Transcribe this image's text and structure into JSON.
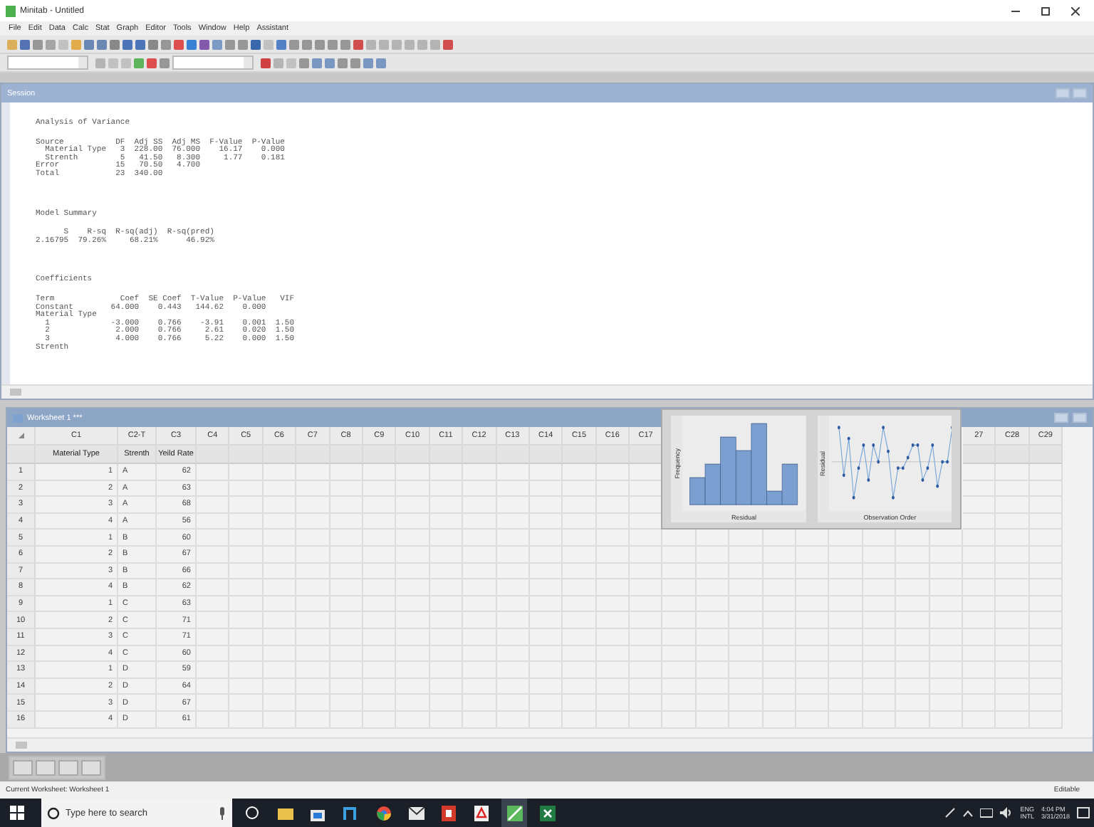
{
  "window": {
    "title": "Minitab - Untitled"
  },
  "menu": [
    "File",
    "Edit",
    "Data",
    "Calc",
    "Stat",
    "Graph",
    "Editor",
    "Tools",
    "Window",
    "Help",
    "Assistant"
  ],
  "session": {
    "title": "Session",
    "sections": [
      {
        "title": "Analysis of Variance",
        "lines": [
          "Source           DF  Adj SS  Adj MS  F-Value  P-Value",
          "  Material Type   3  228.00  76.000    16.17    0.000",
          "  Strenth         5   41.50   8.300     1.77    0.181",
          "Error            15   70.50   4.700",
          "Total            23  340.00"
        ]
      },
      {
        "title": "Model Summary",
        "lines": [
          "      S    R-sq  R-sq(adj)  R-sq(pred)",
          "2.16795  79.26%     68.21%      46.92%"
        ]
      },
      {
        "title": "Coefficients",
        "lines": [
          "Term              Coef  SE Coef  T-Value  P-Value   VIF",
          "Constant        64.000    0.443   144.62    0.000",
          "Material Type",
          "  1             -3.000    0.766    -3.91    0.001  1.50",
          "  2              2.000    0.766     2.61    0.020  1.50",
          "  3              4.000    0.766     5.22    0.000  1.50",
          "Strenth"
        ]
      }
    ]
  },
  "worksheet": {
    "title": "Worksheet 1 ***",
    "columns": [
      {
        "id": "C1",
        "name": "Material Type"
      },
      {
        "id": "C2-T",
        "name": "Strenth"
      },
      {
        "id": "C3",
        "name": "Yeild Rate"
      },
      {
        "id": "C4"
      },
      {
        "id": "C5"
      },
      {
        "id": "C6"
      },
      {
        "id": "C7"
      },
      {
        "id": "C8"
      },
      {
        "id": "C9"
      },
      {
        "id": "C10"
      },
      {
        "id": "C11"
      },
      {
        "id": "C12"
      },
      {
        "id": "C13"
      },
      {
        "id": "C14"
      },
      {
        "id": "C15"
      },
      {
        "id": "C16"
      },
      {
        "id": "C17"
      }
    ],
    "right_columns": [
      "27",
      "C28",
      "C29"
    ],
    "rows": [
      {
        "number": "1",
        "cells": [
          "1",
          "A",
          "62"
        ]
      },
      {
        "number": "2",
        "cells": [
          "2",
          "A",
          "63"
        ]
      },
      {
        "number": "3",
        "cells": [
          "3",
          "A",
          "68"
        ]
      },
      {
        "number": "4",
        "cells": [
          "4",
          "A",
          "56"
        ]
      },
      {
        "number": "5",
        "cells": [
          "1",
          "B",
          "60"
        ]
      },
      {
        "number": "6",
        "cells": [
          "2",
          "B",
          "67"
        ]
      },
      {
        "number": "7",
        "cells": [
          "3",
          "B",
          "66"
        ]
      },
      {
        "number": "8",
        "cells": [
          "4",
          "B",
          "62"
        ]
      },
      {
        "number": "9",
        "cells": [
          "1",
          "C",
          "63"
        ]
      },
      {
        "number": "10",
        "cells": [
          "2",
          "C",
          "71"
        ]
      },
      {
        "number": "11",
        "cells": [
          "3",
          "C",
          "71"
        ]
      },
      {
        "number": "12",
        "cells": [
          "4",
          "C",
          "60"
        ]
      },
      {
        "number": "13",
        "cells": [
          "1",
          "D",
          "59"
        ]
      },
      {
        "number": "14",
        "cells": [
          "2",
          "D",
          "64"
        ]
      },
      {
        "number": "15",
        "cells": [
          "3",
          "D",
          "67"
        ]
      },
      {
        "number": "16",
        "cells": [
          "4",
          "D",
          "61"
        ]
      }
    ]
  },
  "graph": {
    "panels": [
      {
        "kind": "histogram",
        "ylabel": "Frequency",
        "xlabel": "Residual"
      },
      {
        "kind": "versus_order",
        "ylabel": "Residual",
        "xlabel": "Observation Order"
      }
    ]
  },
  "status_bar": {
    "left": "Current Worksheet: Worksheet 1",
    "right": "Editable"
  },
  "taskbar": {
    "search_placeholder": "Type here to search",
    "language": [
      "ENG",
      "INTL"
    ],
    "time": "4:04 PM",
    "date": "3/31/2018"
  }
}
